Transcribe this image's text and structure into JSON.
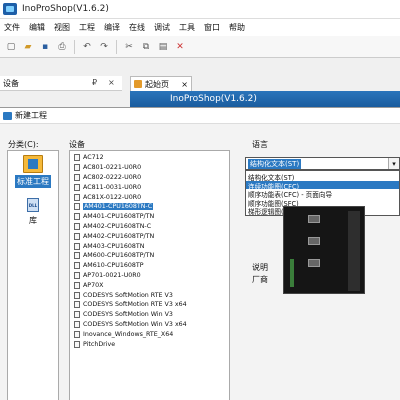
{
  "app": {
    "title": "InoProShop(V1.6.2)"
  },
  "menu": [
    "文件",
    "编辑",
    "视图",
    "工程",
    "编译",
    "在线",
    "调试",
    "工具",
    "窗口",
    "帮助"
  ],
  "toolbar": {
    "icons": [
      "new-icon",
      "open-icon",
      "save-icon",
      "print-icon",
      "undo-icon",
      "redo-icon",
      "cut-icon",
      "copy-icon",
      "paste-icon",
      "delete-icon"
    ]
  },
  "devices_panel": {
    "title": "设备",
    "pin": "₽",
    "close": "×"
  },
  "doc_tab": {
    "label": "起始页",
    "close": "×"
  },
  "banner": {
    "text": "InoProShop(V1.6.2)"
  },
  "dialog": {
    "title": "新建工程",
    "category_label": "分类(C):",
    "device_label": "设备",
    "language_label": "语言",
    "device_label2": "设备",
    "description_label": "说明",
    "vendor_label": "厂商",
    "categories": [
      {
        "label": "标准工程",
        "icon": "standard-project-icon"
      },
      {
        "label": "库",
        "icon": "library-icon",
        "icon_text": "DLL"
      }
    ],
    "devices": [
      "AC712",
      "AC801-0221-U0R0",
      "AC802-0222-U0R0",
      "AC811-0031-U0R0",
      "AC81X-0122-U0R0",
      "AM401-CPU1608TN-C",
      "AM401-CPU1608TP/TN",
      "AM402-CPU1608TN-C",
      "AM402-CPU1608TP/TN",
      "AM403-CPU1608TN",
      "AM600-CPU1608TP/TN",
      "AM610-CPU1608TP",
      "AP701-0021-U0R0",
      "AP70X",
      "CODESYS SoftMotion RTE V3",
      "CODESYS SoftMotion RTE V3 x64",
      "CODESYS SoftMotion Win V3",
      "CODESYS SoftMotion Win V3 x64",
      "Inovance_Windows_RTE_X64",
      "PitchDrive"
    ],
    "selected_device": "AM401-CPU1608TN-C",
    "language": {
      "value": "结构化文本(ST)",
      "options": [
        "结构化文本(ST)",
        "连续功能图(CFC)",
        "顺序功能表(CFC) - 页面向导",
        "顺序功能图(SFC)",
        "梯形逻辑图(LD)"
      ],
      "highlighted": "连续功能图(CFC)"
    }
  }
}
